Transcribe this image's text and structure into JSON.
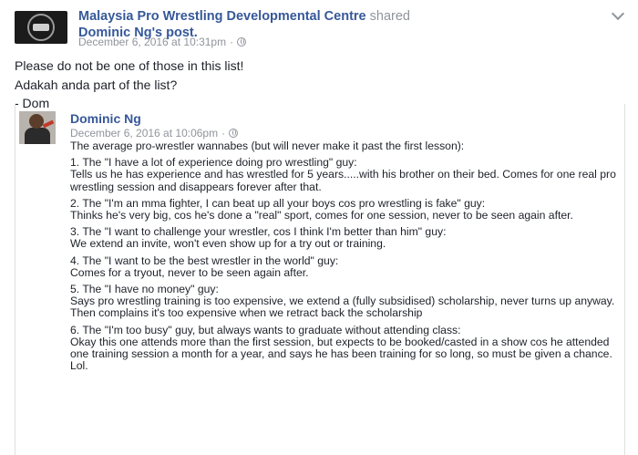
{
  "header": {
    "page_name": "Malaysia Pro Wrestling Developmental Centre",
    "shared_word": "shared",
    "original_author": "Dominic Ng",
    "post_suffix": "'s post.",
    "timestamp": "December 6, 2016 at 10:31pm",
    "separator": "·"
  },
  "share_message": [
    "Please do not be one of those in this list!",
    "Adakah anda part of the list?",
    "- Dom"
  ],
  "inner_post": {
    "author": "Dominic Ng",
    "timestamp": "December 6, 2016 at 10:06pm",
    "separator": "·",
    "intro": "The average pro-wrestler wannabes (but will never make it past the first lesson):",
    "items": [
      {
        "title": "1. The \"I have a lot of experience doing pro wrestling\" guy:",
        "detail": "Tells us he has experience and has wrestled for 5 years.....with his brother on their bed. Comes for one real pro wrestling session and disappears forever after that."
      },
      {
        "title": "2. The \"I'm an mma fighter, I can beat up all your boys cos pro wrestling is fake\" guy:",
        "detail": "Thinks he's very big, cos he's done a \"real\" sport, comes for one session, never to be seen again after."
      },
      {
        "title": "3. The \"I want to challenge your wrestler, cos I think I'm better than him\" guy:",
        "detail": "We extend an invite, won't even show up for a try out or training."
      },
      {
        "title": "4. The \"I want to be the best wrestler in the world\" guy:",
        "detail": "Comes for a tryout, never to be seen again after."
      },
      {
        "title": "5. The \"I have no money\" guy:",
        "detail": "Says pro wrestling training is too expensive, we extend a (fully subsidised) scholarship, never turns up anyway. Then complains it's too expensive when we retract back the scholarship"
      },
      {
        "title": "6. The \"I'm too busy\" guy, but always wants to graduate without attending class:",
        "detail": "Okay this one attends more than the first session, but expects to be booked/casted in a show cos he attended one training session a month for a year, and says he has been training for so long, so must be given a chance. Lol."
      }
    ]
  },
  "icons": {
    "page_avatar": "wrestling-centre-logo",
    "author_avatar": "profile-photo",
    "privacy": "globe-icon",
    "menu": "chevron-down-icon"
  },
  "colors": {
    "link": "#365899",
    "muted": "#90949c",
    "text": "#1d2129"
  }
}
